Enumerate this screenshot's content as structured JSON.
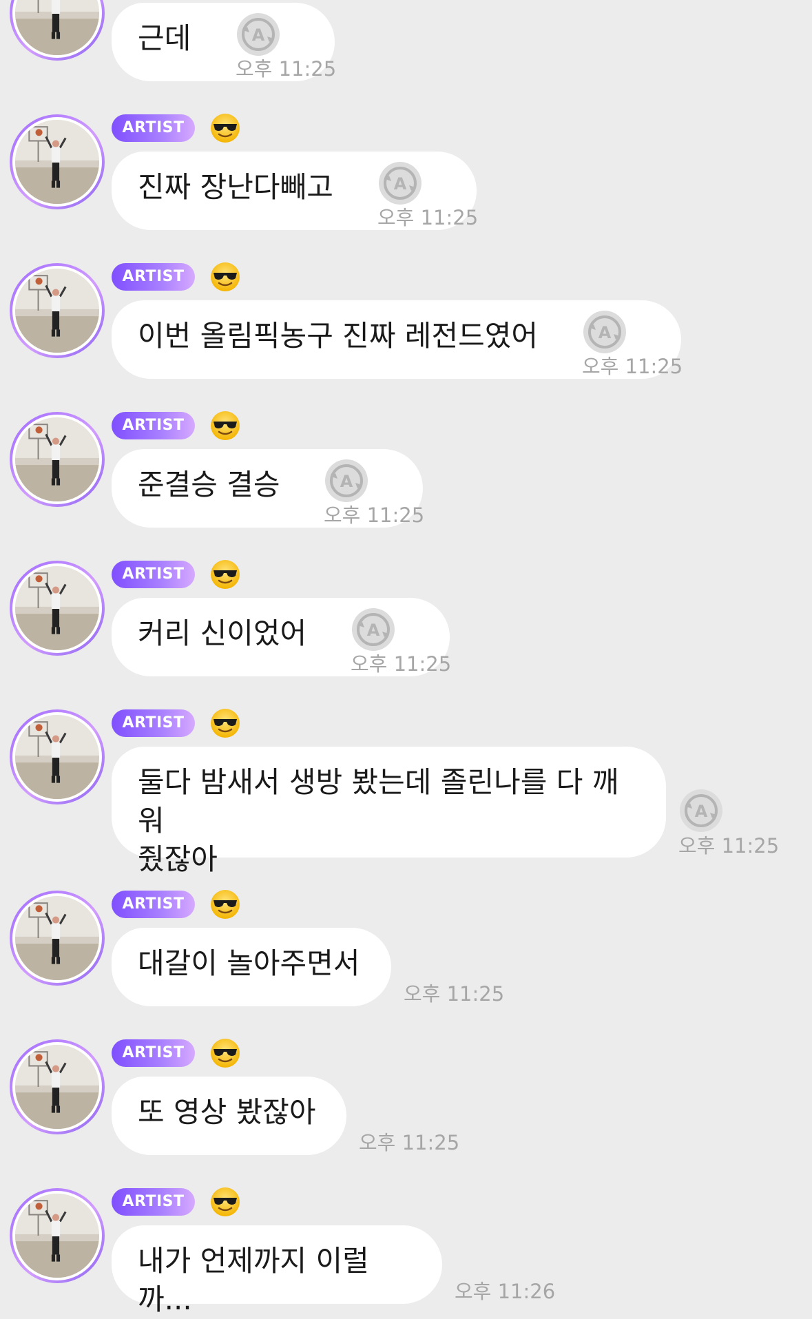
{
  "badge_label": "ARTIST",
  "colors": {
    "background": "#ececec",
    "bubble": "#ffffff",
    "badge_start": "#7f4fff",
    "badge_end": "#d6a9ff",
    "avatar_ring": "#a874ff",
    "timestamp": "#a6a6a6"
  },
  "icons": {
    "emoji": "smiling-face-with-sunglasses",
    "translate": "translate-a-icon"
  },
  "messages": [
    {
      "text": "근데",
      "time": "오후 11:25",
      "translate": true,
      "badge": false
    },
    {
      "text": "진짜 장난다빼고",
      "time": "오후 11:25",
      "translate": true,
      "badge": true
    },
    {
      "text": "이번 올림픽농구 진짜 레전드였어",
      "time": "오후 11:25",
      "translate": true,
      "badge": true
    },
    {
      "text": "준결승 결승",
      "time": "오후 11:25",
      "translate": true,
      "badge": true
    },
    {
      "text": "커리 신이었어",
      "time": "오후 11:25",
      "translate": true,
      "badge": true
    },
    {
      "text": "둘다 밤새서 생방 봤는데 졸린나를 다 깨워\n줬잖아",
      "time": "오후 11:25",
      "translate": true,
      "badge": true
    },
    {
      "text": "대갈이 놀아주면서",
      "time": "오후 11:25",
      "translate": false,
      "badge": true
    },
    {
      "text": "또 영상 봤잖아",
      "time": "오후 11:25",
      "translate": false,
      "badge": true
    },
    {
      "text": "내가 언제까지 이럴까...",
      "time": "오후 11:26",
      "translate": false,
      "badge": true
    }
  ]
}
